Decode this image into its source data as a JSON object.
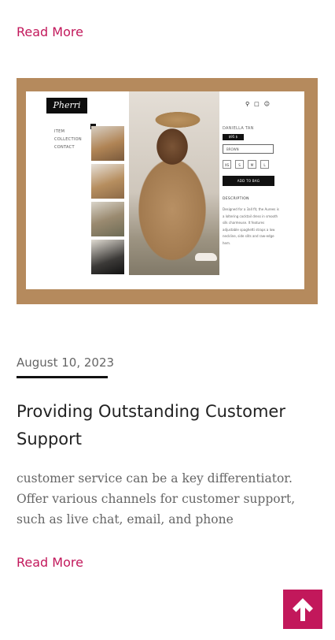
{
  "previous_post": {
    "read_more": "Read More"
  },
  "featured_image": {
    "logo": "Pherri",
    "menu": [
      "ITEM",
      "COLLECTION",
      "CONTACT"
    ],
    "header_icons": [
      "search-icon",
      "bag-icon",
      "user-icon"
    ],
    "product_name": "DANIELLA TAN",
    "price": "$95 $",
    "color_option": "BROWN",
    "sizes": [
      "XS",
      "S",
      "M",
      "L"
    ],
    "add_to_bag": "ADD TO BAG",
    "description_heading": "DESCRIPTION",
    "description_text": "Designed for a 3all fit, the Aurees is a loltering cocktail dress in smooth silk charmeuse. It features adjustable spaghetti straps a low neckline, side slits and raw-edge hem."
  },
  "post": {
    "date": "August 10, 2023",
    "title": "Providing Outstanding Customer Support",
    "excerpt": "customer service can be a key differentiator. Offer various channels for customer support, such as live chat, email, and phone",
    "read_more": "Read More"
  },
  "colors": {
    "accent": "#c2185b",
    "image_border": "#b58a5d"
  },
  "scroll_top": {
    "icon": "arrow-up-icon"
  }
}
